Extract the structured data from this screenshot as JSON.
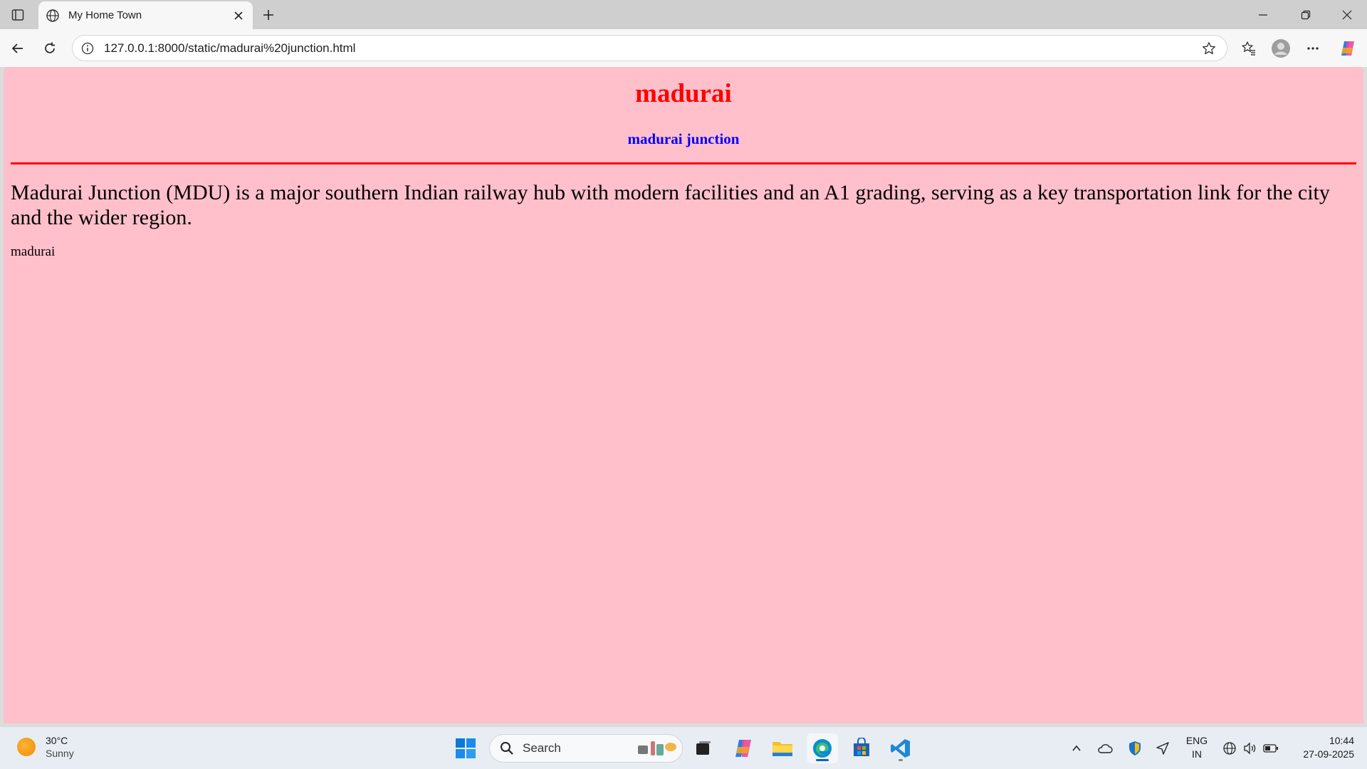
{
  "browser": {
    "tab": {
      "title": "My Home Town"
    },
    "address": {
      "url": "127.0.0.1:8000/static/madurai%20junction.html"
    }
  },
  "page": {
    "heading": "madurai",
    "subheading": "madurai junction",
    "paragraph": "Madurai Junction (MDU) is a major southern Indian railway hub with modern facilities and an A1 grading, serving as a key transportation link for the city and the wider region.",
    "footer_text": "madurai",
    "colors": {
      "background": "#ffc0cb",
      "heading": "#ff0000",
      "subheading": "#0000ff",
      "rule": "#ff0000"
    }
  },
  "taskbar": {
    "weather": {
      "temp": "30°C",
      "condition": "Sunny"
    },
    "search": {
      "placeholder": "Search"
    },
    "language": {
      "line1": "ENG",
      "line2": "IN"
    },
    "clock": {
      "time": "10:44",
      "date": "27-09-2025"
    }
  }
}
